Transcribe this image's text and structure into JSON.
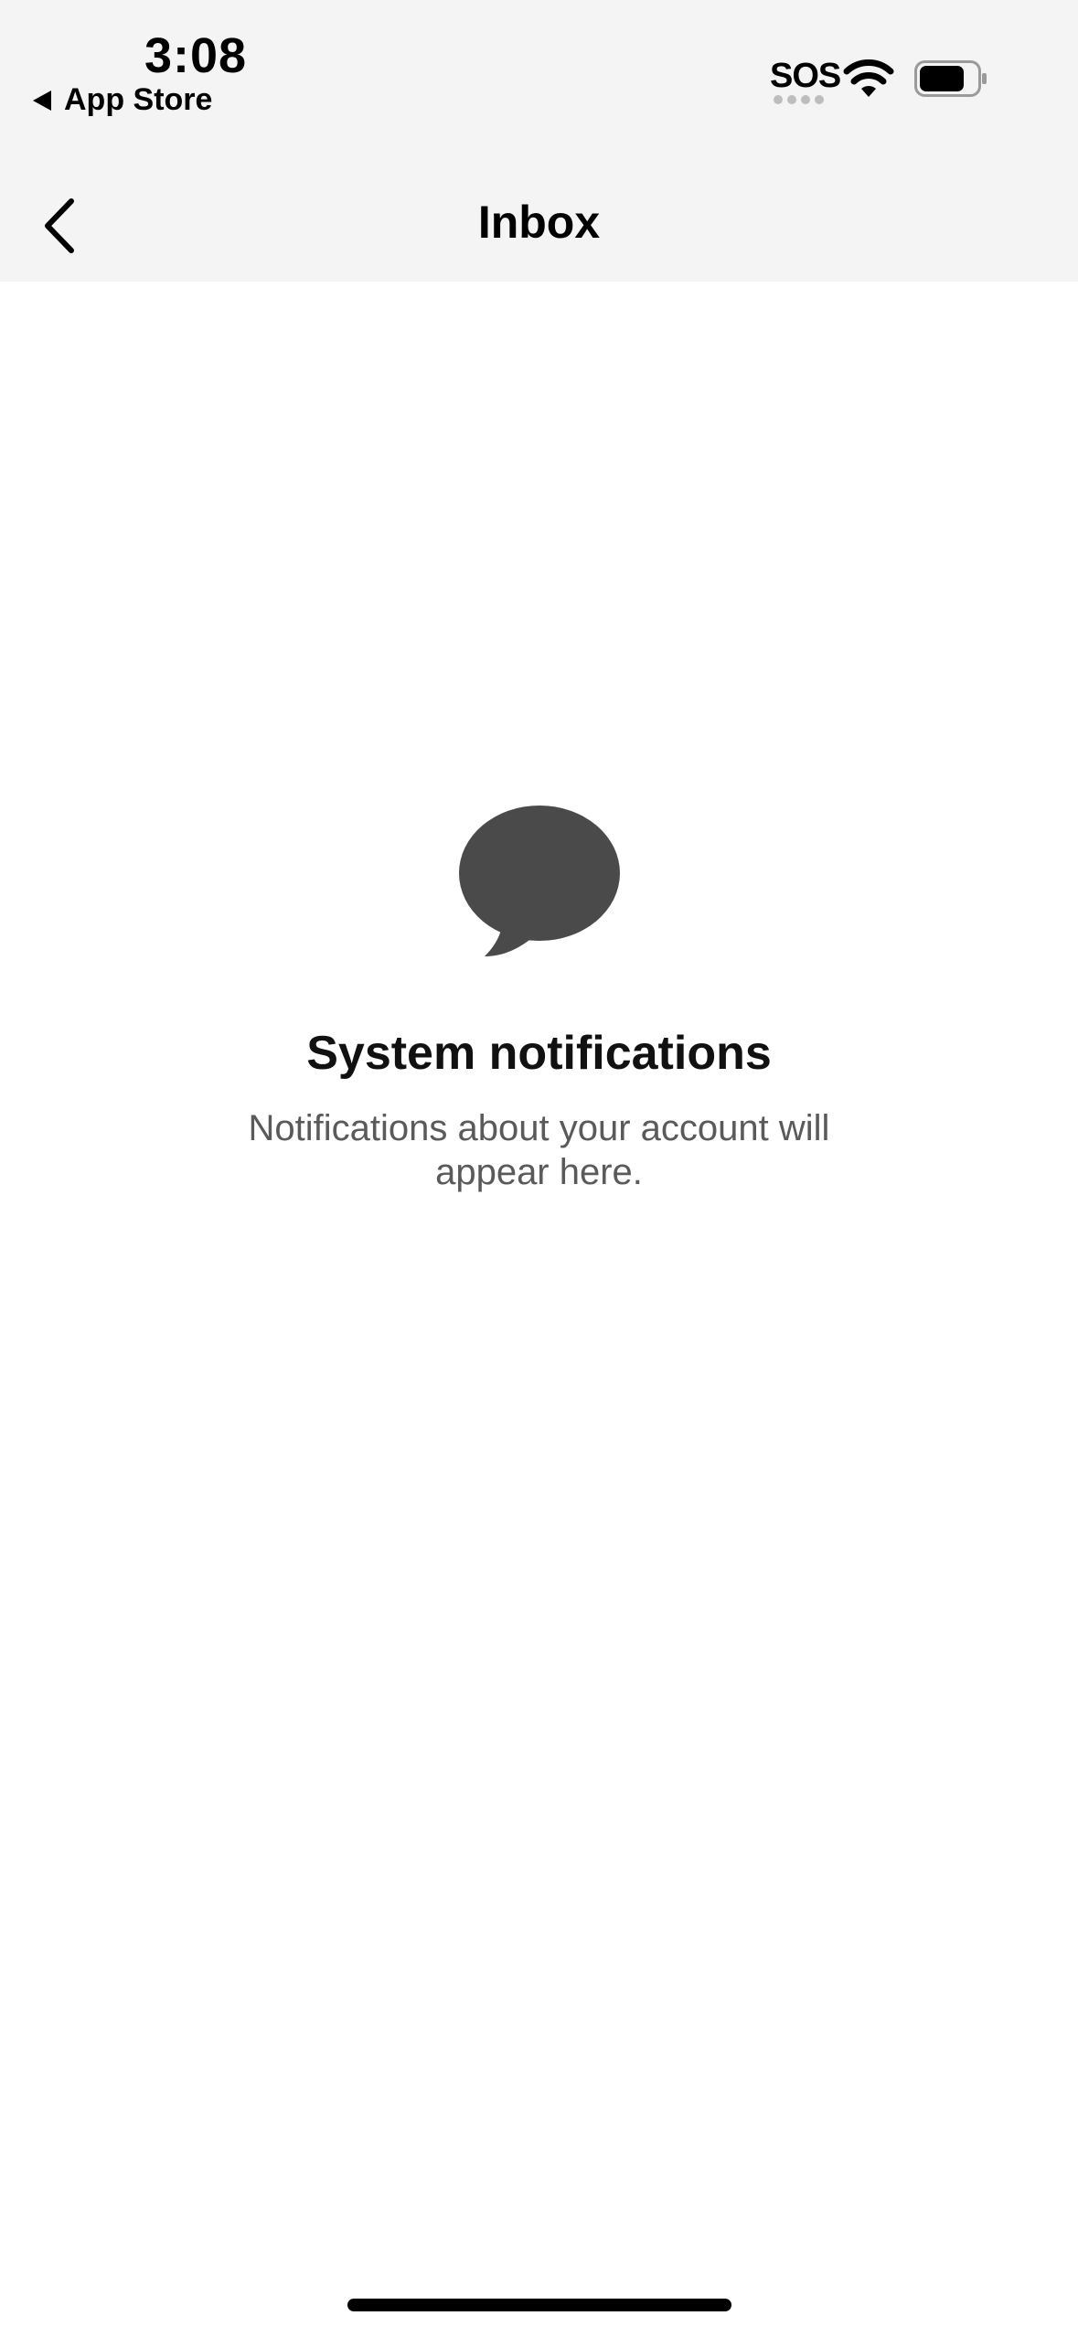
{
  "status_bar": {
    "time": "3:08",
    "back_app": "App Store",
    "sos": "SOS"
  },
  "nav": {
    "title": "Inbox",
    "back_icon": "chevron-left-icon"
  },
  "empty_state": {
    "icon": "speech-bubble-icon",
    "title": "System notifications",
    "description": "Notifications about your account will appear here."
  },
  "colors": {
    "header_bg": "#f4f4f4",
    "icon": "#4a4a4a",
    "secondary_text": "#5a5a5a"
  }
}
